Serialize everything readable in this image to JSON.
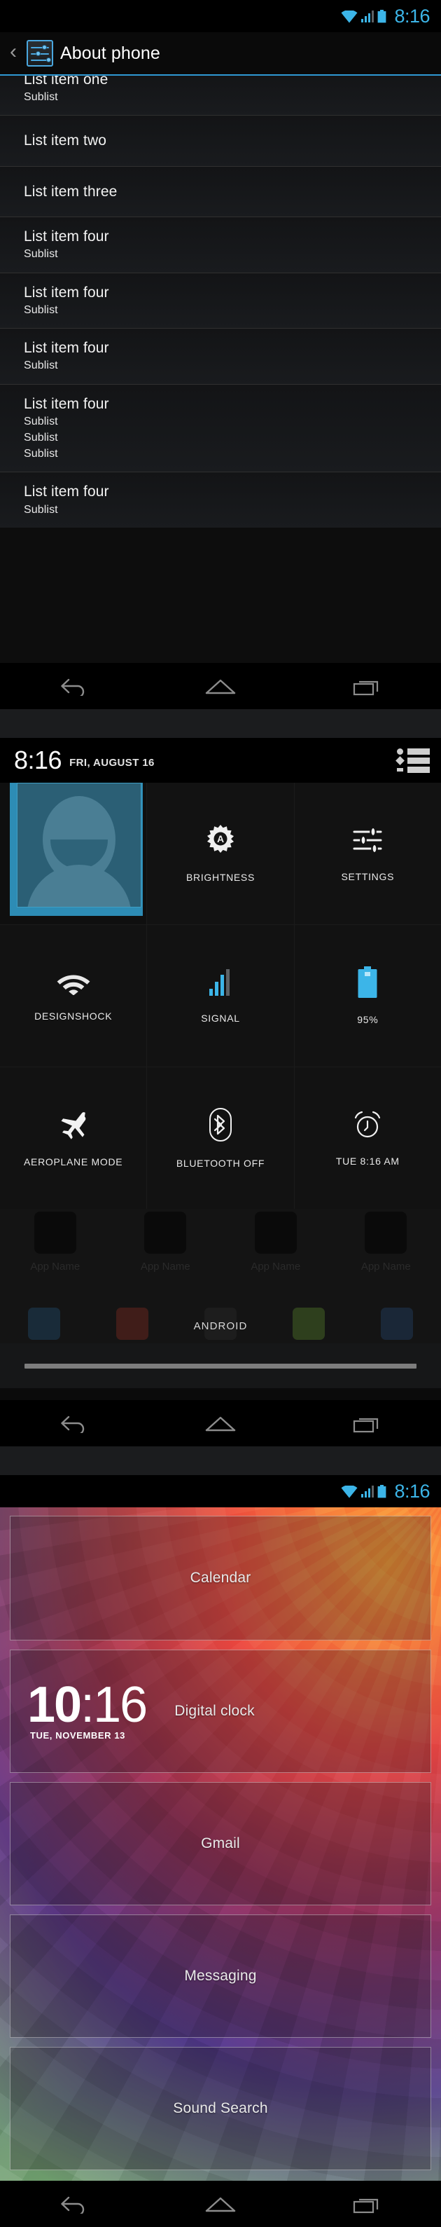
{
  "statusbar": {
    "time": "8:16",
    "wifi_icon": "wifi-icon",
    "signal_icon": "signal-icon",
    "battery_icon": "battery-icon",
    "accent": "#3cb5e8"
  },
  "navbar": {
    "back": "back-icon",
    "home": "home-icon",
    "recents": "recents-icon"
  },
  "about_screen": {
    "actionbar": {
      "back_label": "‹",
      "icon": "settings-sliders-icon",
      "title": "About phone"
    },
    "rows": [
      {
        "title": "List item one",
        "subs": [
          "Sublist"
        ]
      },
      {
        "title": "List item two",
        "subs": []
      },
      {
        "title": "List item three",
        "subs": []
      },
      {
        "title": "List item four",
        "subs": [
          "Sublist"
        ]
      },
      {
        "title": "List item four",
        "subs": [
          "Sublist"
        ]
      },
      {
        "title": "List item four",
        "subs": [
          "Sublist"
        ]
      },
      {
        "title": "List item four",
        "subs": [
          "Sublist",
          "Sublist",
          "Sublist"
        ]
      },
      {
        "title": "List item four",
        "subs": [
          "Sublist"
        ]
      }
    ]
  },
  "quick_settings": {
    "header": {
      "clock": "8:16",
      "date": "FRI, AUGUST 16",
      "list_icon": "notification-list-icon"
    },
    "tiles": [
      {
        "name": "user-avatar-tile",
        "icon": "avatar-icon",
        "label": ""
      },
      {
        "name": "brightness-tile",
        "icon": "brightness-auto-icon",
        "label": "BRIGHTNESS"
      },
      {
        "name": "settings-tile",
        "icon": "settings-sliders-icon",
        "label": "SETTINGS"
      },
      {
        "name": "wifi-tile",
        "icon": "wifi-icon",
        "label": "DESIGNSHOCK"
      },
      {
        "name": "signal-tile",
        "icon": "signal-icon",
        "label": "SIGNAL"
      },
      {
        "name": "battery-tile",
        "icon": "battery-icon",
        "label": "95%"
      },
      {
        "name": "aeroplane-mode-tile",
        "icon": "aeroplane-icon",
        "label": "AEROPLANE MODE"
      },
      {
        "name": "bluetooth-tile",
        "icon": "bluetooth-icon",
        "label": "BLUETOOTH OFF"
      },
      {
        "name": "alarm-tile",
        "icon": "alarm-clock-icon",
        "label": "TUE 8:16 AM"
      }
    ],
    "ghost": {
      "app_names": [
        "App Name",
        "App Name",
        "App Name",
        "App Name"
      ],
      "label": "ANDROID"
    }
  },
  "widget_picker": {
    "widgets": [
      {
        "name": "Calendar"
      },
      {
        "name": "Digital clock",
        "clock_hour": "10",
        "clock_sep": ":",
        "clock_min": "16",
        "clock_date": "TUE, NOVEMBER 13"
      },
      {
        "name": "Gmail"
      },
      {
        "name": "Messaging"
      },
      {
        "name": "Sound Search"
      }
    ]
  }
}
